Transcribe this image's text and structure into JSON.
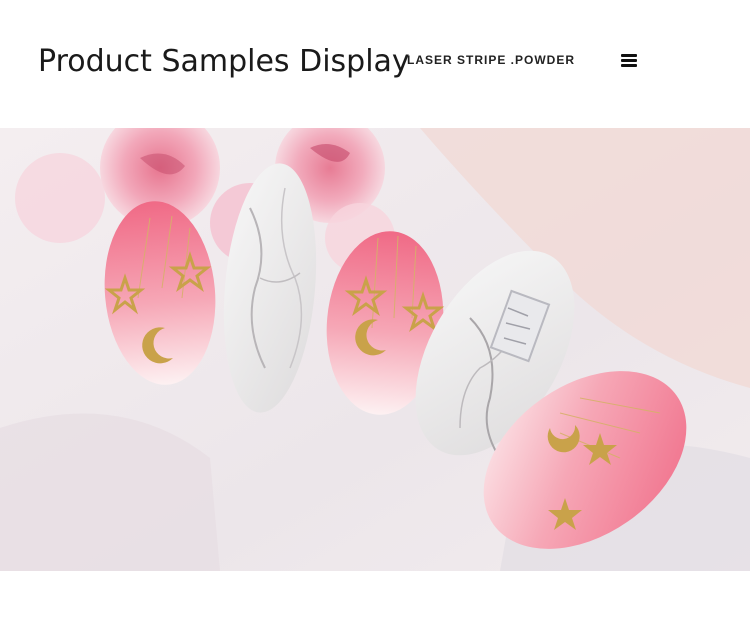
{
  "header": {
    "title": "Product Samples Display",
    "subtitle": "LASER STRIPE .POWDER",
    "menu_icon": "hamburger-menu-icon"
  },
  "photo": {
    "subject": "nail-samples-photo",
    "colors": {
      "pink": "#f07a92",
      "pale_pink": "#fbe3e6",
      "marble": "#efefef",
      "gold": "#c9a24a",
      "rose": "#e98aa4"
    }
  }
}
